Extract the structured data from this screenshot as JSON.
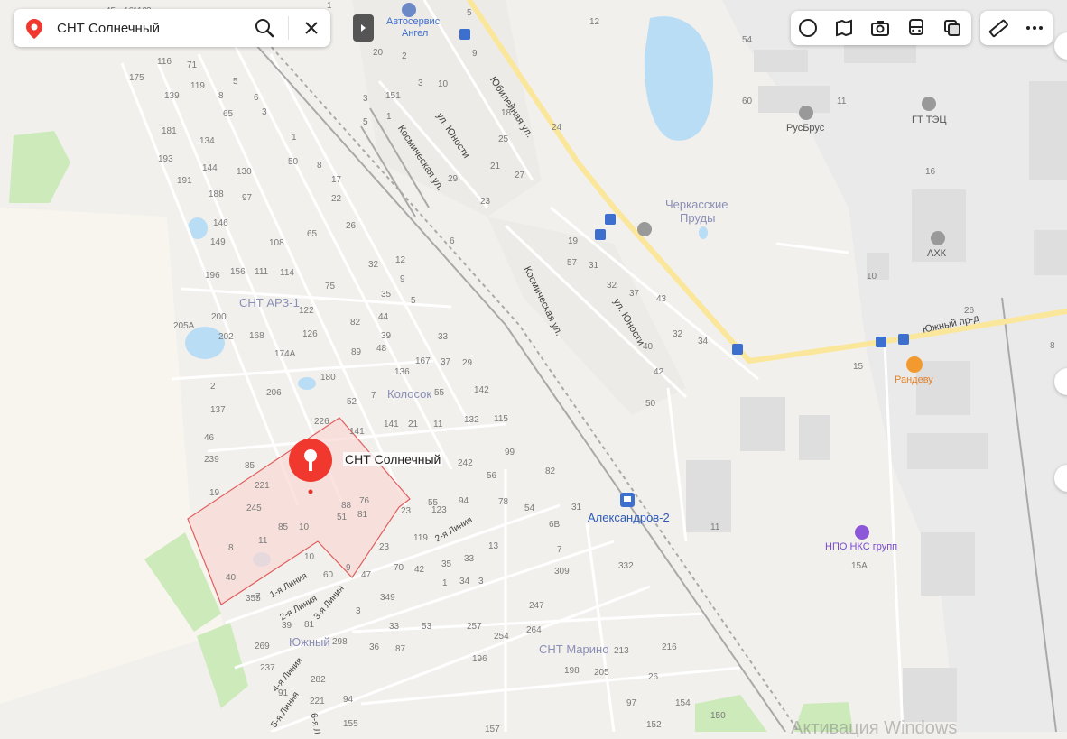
{
  "search": {
    "query": "СНТ Солнечный",
    "search_button": "search",
    "clear_button": "clear"
  },
  "toolbar": {
    "items": [
      "traffic-icon",
      "panorama-icon",
      "photo-icon",
      "transit-icon",
      "layers-icon"
    ],
    "ruler": "ruler-icon",
    "more": "more-icon"
  },
  "selected_place": {
    "name": "СНТ Солнечный",
    "marker_color": "#f0382f",
    "polygon_fill": "#f9d7d4",
    "polygon_stroke": "#e05e5e"
  },
  "areas": {
    "snt_arz": "СНТ АРЗ-1",
    "kolosok": "Колосок",
    "yuzhny": "Южный",
    "snt_marino": "СНТ Марино",
    "cherkasskie_1": "Черкасские",
    "cherkasskie_2": "Пруды"
  },
  "pois": {
    "avtoservis_1": "Автосервис",
    "avtoservis_2": "Ангел",
    "rusbrus": "РусБрус",
    "gt_tec": "ГТ ТЭЦ",
    "axk": "АХК",
    "randevu": "Рандеву",
    "npo": "НПО НКС групп",
    "station": "Александров-2"
  },
  "streets": {
    "yubileynaya": "Юбилейная ул.",
    "yunosti_1": "ул. Юности",
    "kosmicheskaya_1": "Космическая ул.",
    "kosmicheskaya_2": "Космическая ул.",
    "yunosti_2": "ул. Юности",
    "yuzhny_pr": "Южный пр-д",
    "liniya_1": "1-я Линия",
    "liniya_2a": "2-я Линия",
    "liniya_2b": "2-я Линия",
    "liniya_3": "3-я Линия",
    "liniya_4": "4-я Линия",
    "liniya_5": "5-я Линия",
    "liniya_6": "6-я Л"
  },
  "house_numbers": [
    "16",
    "116",
    "71",
    "175",
    "119",
    "5",
    "139",
    "8",
    "6",
    "181",
    "134",
    "65",
    "3",
    "193",
    "144",
    "130",
    "1",
    "191",
    "188",
    "97",
    "50",
    "8",
    "17",
    "22",
    "146",
    "149",
    "108",
    "65",
    "26",
    "196",
    "156",
    "111",
    "114",
    "75",
    "32",
    "12",
    "9",
    "5",
    "122",
    "82",
    "44",
    "35",
    "200",
    "202",
    "168",
    "126",
    "89",
    "48",
    "39",
    "205A",
    "174A",
    "33",
    "167",
    "37",
    "29",
    "2",
    "206",
    "180",
    "136",
    "55",
    "7",
    "52",
    "142",
    "137",
    "226",
    "141",
    "21",
    "11",
    "132",
    "115",
    "141",
    "46",
    "239",
    "242",
    "99",
    "85",
    "221",
    "56",
    "82",
    "19",
    "245",
    "55",
    "94",
    "78",
    "54",
    "23",
    "123",
    "76",
    "88",
    "81",
    "51",
    "85",
    "10",
    "11",
    "8",
    "23",
    "119",
    "70",
    "42",
    "35",
    "33",
    "13",
    "10",
    "9",
    "47",
    "60",
    "34",
    "40",
    "7",
    "1",
    "3",
    "7",
    "309",
    "332",
    "355",
    "349",
    "3",
    "39",
    "81",
    "33",
    "53",
    "257",
    "254",
    "264",
    "247",
    "269",
    "298",
    "36",
    "87",
    "196",
    "198",
    "205",
    "213",
    "216",
    "237",
    "282",
    "26",
    "91",
    "221",
    "94",
    "97",
    "154",
    "150",
    "155",
    "157",
    "152",
    "45",
    "112",
    "2",
    "3",
    "5",
    "2",
    "3",
    "10",
    "9",
    "18",
    "23",
    "25",
    "21",
    "27",
    "29",
    "24",
    "19",
    "57",
    "31",
    "32",
    "37",
    "43",
    "32",
    "34",
    "40",
    "42",
    "50",
    "54",
    "60",
    "11",
    "16",
    "15",
    "10",
    "26",
    "8",
    "11",
    "15A",
    "12",
    "6",
    "6B",
    "31",
    "1",
    "5",
    "20",
    "151",
    "1",
    "3",
    "2",
    "6",
    "4"
  ],
  "map_colors": {
    "background": "#f2f0ec",
    "water": "#b9ddf5",
    "green": "#cdeabb",
    "road_major": "#fbe79b",
    "road_minor": "#ffffff",
    "rail": "#a9a9a9",
    "industrial": "#e4e4e4"
  },
  "watermark": "Активация Windows"
}
